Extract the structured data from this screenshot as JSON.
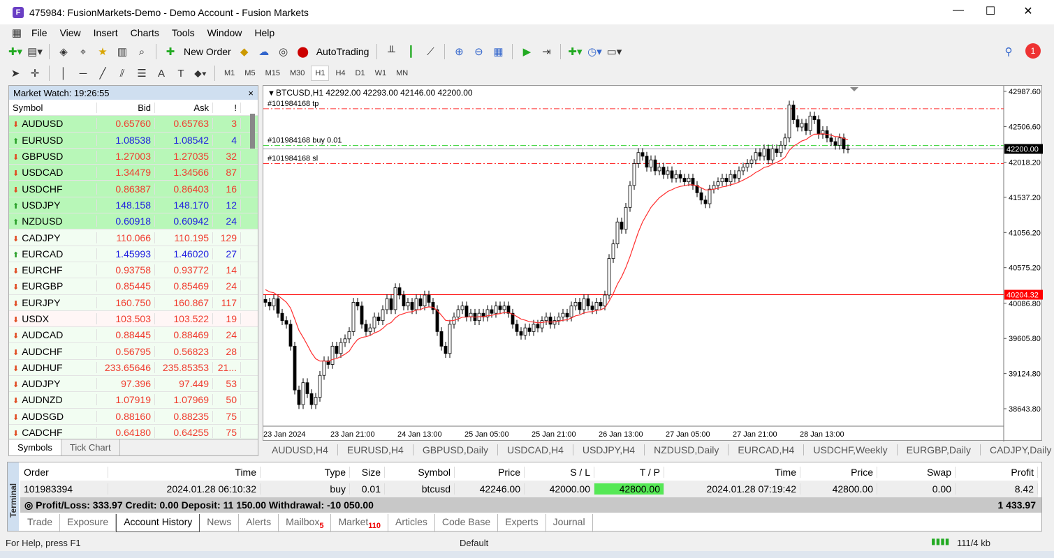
{
  "window": {
    "title": "475984: FusionMarkets-Demo - Demo Account - Fusion Markets",
    "minimize": "—",
    "maximize": "☐",
    "close": "✕",
    "app_icon": "F"
  },
  "menu": [
    "File",
    "View",
    "Insert",
    "Charts",
    "Tools",
    "Window",
    "Help"
  ],
  "toolbar": {
    "new_order": "New Order",
    "autotrading": "AutoTrading",
    "notification_count": "1"
  },
  "timeframes": [
    "M1",
    "M5",
    "M15",
    "M30",
    "H1",
    "H4",
    "D1",
    "W1",
    "MN"
  ],
  "active_timeframe": "H1",
  "market_watch": {
    "title": "Market Watch: 19:26:55",
    "close": "×",
    "columns": [
      "Symbol",
      "Bid",
      "Ask",
      "!"
    ],
    "rows": [
      {
        "symbol": "AUDUSD",
        "bid": "0.65760",
        "ask": "0.65763",
        "spread": "3",
        "dir": "down",
        "hl": true
      },
      {
        "symbol": "EURUSD",
        "bid": "1.08538",
        "ask": "1.08542",
        "spread": "4",
        "dir": "up",
        "hl": true
      },
      {
        "symbol": "GBPUSD",
        "bid": "1.27003",
        "ask": "1.27035",
        "spread": "32",
        "dir": "down",
        "hl": true
      },
      {
        "symbol": "USDCAD",
        "bid": "1.34479",
        "ask": "1.34566",
        "spread": "87",
        "dir": "down",
        "hl": true
      },
      {
        "symbol": "USDCHF",
        "bid": "0.86387",
        "ask": "0.86403",
        "spread": "16",
        "dir": "down",
        "hl": true
      },
      {
        "symbol": "USDJPY",
        "bid": "148.158",
        "ask": "148.170",
        "spread": "12",
        "dir": "up",
        "hl": true
      },
      {
        "symbol": "NZDUSD",
        "bid": "0.60918",
        "ask": "0.60942",
        "spread": "24",
        "dir": "up",
        "hl": true
      },
      {
        "symbol": "CADJPY",
        "bid": "110.066",
        "ask": "110.195",
        "spread": "129",
        "dir": "down",
        "hl": false
      },
      {
        "symbol": "EURCAD",
        "bid": "1.45993",
        "ask": "1.46020",
        "spread": "27",
        "dir": "up",
        "hl": false
      },
      {
        "symbol": "EURCHF",
        "bid": "0.93758",
        "ask": "0.93772",
        "spread": "14",
        "dir": "down",
        "hl": false
      },
      {
        "symbol": "EURGBP",
        "bid": "0.85445",
        "ask": "0.85469",
        "spread": "24",
        "dir": "down",
        "hl": false
      },
      {
        "symbol": "EURJPY",
        "bid": "160.750",
        "ask": "160.867",
        "spread": "117",
        "dir": "down",
        "hl": false
      },
      {
        "symbol": "USDX",
        "bid": "103.503",
        "ask": "103.522",
        "spread": "19",
        "dir": "down",
        "hl": false
      },
      {
        "symbol": "AUDCAD",
        "bid": "0.88445",
        "ask": "0.88469",
        "spread": "24",
        "dir": "down",
        "hl": false
      },
      {
        "symbol": "AUDCHF",
        "bid": "0.56795",
        "ask": "0.56823",
        "spread": "28",
        "dir": "down",
        "hl": false
      },
      {
        "symbol": "AUDHUF",
        "bid": "233.65646",
        "ask": "235.85353",
        "spread": "21...",
        "dir": "down",
        "hl": false
      },
      {
        "symbol": "AUDJPY",
        "bid": "97.396",
        "ask": "97.449",
        "spread": "53",
        "dir": "down",
        "hl": false
      },
      {
        "symbol": "AUDNZD",
        "bid": "1.07919",
        "ask": "1.07969",
        "spread": "50",
        "dir": "down",
        "hl": false
      },
      {
        "symbol": "AUDSGD",
        "bid": "0.88160",
        "ask": "0.88235",
        "spread": "75",
        "dir": "down",
        "hl": false
      },
      {
        "symbol": "CADCHF",
        "bid": "0.64180",
        "ask": "0.64255",
        "spread": "75",
        "dir": "down",
        "hl": false
      }
    ],
    "tabs": [
      "Symbols",
      "Tick Chart"
    ]
  },
  "chart": {
    "header": "BTCUSD,H1  42292.00 42293.00 42146.00 42200.00",
    "labels": {
      "tp": "#101984168 tp",
      "buy": "#101984168 buy 0.01",
      "sl": "#101984168 sl"
    },
    "levels": {
      "tp": 42750,
      "buy": 42246,
      "sl": 42000,
      "bid": 42200.0,
      "alert": 40204.32
    },
    "bid_label": "42200.00",
    "alert_label": "40204.32",
    "y_ticks": [
      "42987.60",
      "42506.60",
      "42018.20",
      "41537.20",
      "41056.20",
      "40575.20",
      "40086.80",
      "39605.80",
      "39124.80",
      "38643.80"
    ],
    "x_ticks": [
      "23 Jan 2024",
      "23 Jan 21:00",
      "24 Jan 13:00",
      "25 Jan 05:00",
      "25 Jan 21:00",
      "26 Jan 13:00",
      "27 Jan 05:00",
      "27 Jan 21:00",
      "28 Jan 13:00"
    ],
    "closes": [
      40100,
      40050,
      40150,
      39950,
      39850,
      39800,
      39500,
      38900,
      38700,
      39000,
      38850,
      38700,
      38800,
      39100,
      39300,
      39250,
      39500,
      39400,
      39550,
      39600,
      39700,
      40100,
      40050,
      39800,
      39700,
      39750,
      39900,
      39850,
      40000,
      40150,
      40000,
      40300,
      40200,
      40050,
      40100,
      40000,
      40150,
      40050,
      40200,
      40100,
      40000,
      39700,
      39500,
      39400,
      39800,
      39900,
      40000,
      40050,
      39900,
      39950,
      39850,
      39950,
      39900,
      40000,
      39950,
      40050,
      40000,
      40050,
      39950,
      39800,
      39700,
      39650,
      39750,
      39700,
      39800,
      39750,
      39850,
      39900,
      39800,
      39850,
      39900,
      39950,
      39900,
      40050,
      40100,
      40000,
      40150,
      40050,
      40000,
      40100,
      40050,
      40200,
      40700,
      40900,
      41200,
      41100,
      41400,
      41700,
      42000,
      42150,
      42100,
      41950,
      42050,
      41900,
      41950,
      41850,
      41900,
      41800,
      41850,
      41800,
      41750,
      41800,
      41700,
      41600,
      41500,
      41450,
      41650,
      41700,
      41750,
      41800,
      41750,
      41850,
      41800,
      41900,
      41950,
      42000,
      42050,
      42150,
      42100,
      42200,
      42050,
      42200,
      42150,
      42250,
      42350,
      42800,
      42600,
      42500,
      42550,
      42450,
      42650,
      42600,
      42400,
      42450,
      42350,
      42300,
      42250,
      42350,
      42200,
      42200
    ],
    "colors": {
      "up": "#ffffff",
      "down": "#000000",
      "ma": "#ff3030",
      "tp_sl": "#ff3030",
      "buy": "#30d030",
      "alert": "#ff0000"
    }
  },
  "chart_tabs": [
    "AUDUSD,H4",
    "EURUSD,H4",
    "GBPUSD,Daily",
    "USDCAD,H4",
    "USDJPY,H4",
    "NZDUSD,Daily",
    "EURCAD,H4",
    "USDCHF,Weekly",
    "EURGBP,Daily",
    "CADJPY,Daily"
  ],
  "terminal": {
    "side_label": "Terminal",
    "columns": [
      "Order",
      "Time",
      "Type",
      "Size",
      "Symbol",
      "Price",
      "S / L",
      "T / P",
      "Time",
      "Price",
      "Swap",
      "Profit"
    ],
    "row": [
      "101983394",
      "2024.01.28 06:10:32",
      "buy",
      "0.01",
      "btcusd",
      "42246.00",
      "42000.00",
      "42800.00",
      "2024.01.28 07:19:42",
      "42800.00",
      "0.00",
      "8.42"
    ],
    "summary": "Profit/Loss: 333.97  Credit: 0.00  Deposit: 11 150.00  Withdrawal: -10 050.00",
    "total": "1 433.97",
    "tabs": [
      {
        "label": "Trade"
      },
      {
        "label": "Exposure"
      },
      {
        "label": "Account History",
        "active": true
      },
      {
        "label": "News"
      },
      {
        "label": "Alerts"
      },
      {
        "label": "Mailbox",
        "badge": "5"
      },
      {
        "label": "Market",
        "badge": "110"
      },
      {
        "label": "Articles"
      },
      {
        "label": "Code Base"
      },
      {
        "label": "Experts"
      },
      {
        "label": "Journal"
      }
    ]
  },
  "status": {
    "help": "For Help, press F1",
    "profile": "Default",
    "traffic": "111/4 kb"
  }
}
